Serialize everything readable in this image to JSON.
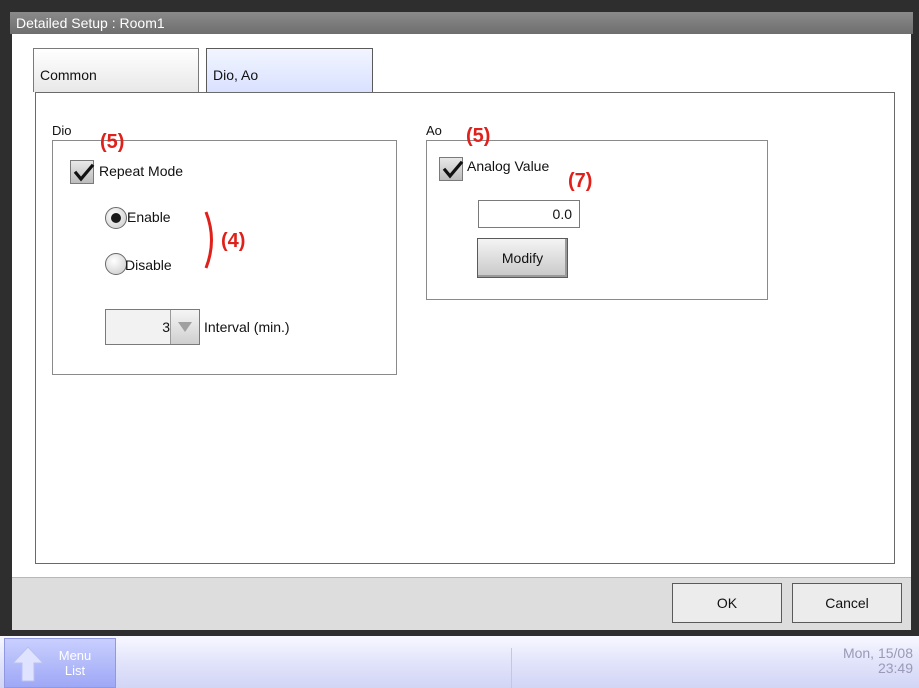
{
  "window": {
    "title": "Detailed Setup : Room1"
  },
  "tabs": [
    {
      "label": "Common",
      "active": false
    },
    {
      "label": "Dio, Ao",
      "active": true
    }
  ],
  "dio": {
    "group_label": "Dio",
    "repeat_mode": {
      "label": "Repeat Mode",
      "checked": true
    },
    "radios": [
      {
        "label": "Enable",
        "selected": true
      },
      {
        "label": "Disable",
        "selected": false
      }
    ],
    "interval": {
      "value": "3",
      "label": "Interval (min.)"
    }
  },
  "ao": {
    "group_label": "Ao",
    "analog_value": {
      "label": "Analog Value",
      "checked": true
    },
    "value": "0.0",
    "modify_label": "Modify"
  },
  "annotations": {
    "dio_checkbox": "(5)",
    "radio_group": "(4)",
    "ao_checkbox": "(5)",
    "ao_value": "(7)"
  },
  "footer": {
    "ok_label": "OK",
    "cancel_label": "Cancel"
  },
  "taskbar": {
    "menu_label_1": "Menu",
    "menu_label_2": "List",
    "date": "Mon, 15/08",
    "time": "23:49"
  },
  "colors": {
    "annotation": "#e0201a",
    "title_bar": "#7a7a7a",
    "active_tab": "#dde3ff",
    "taskbar": "#e2e4fb"
  }
}
